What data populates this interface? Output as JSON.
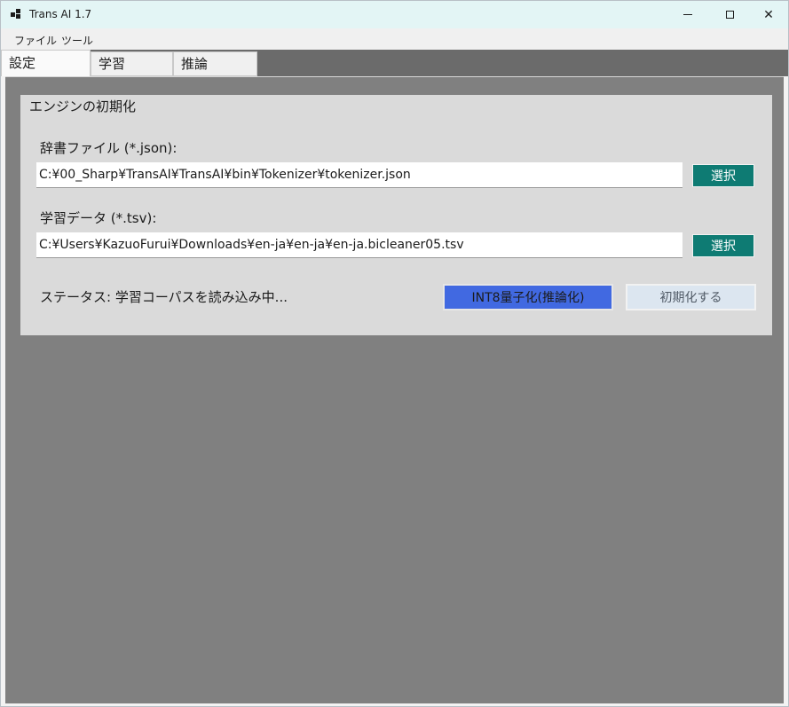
{
  "window": {
    "title": "Trans AI 1.7",
    "controls": {
      "minimize": "—",
      "maximize": "□",
      "close": "✕"
    }
  },
  "menu": {
    "items": [
      "ファイル",
      "ツール"
    ]
  },
  "tabs": [
    "設定",
    "学習",
    "推論"
  ],
  "active_tab": "設定",
  "engine": {
    "group_title": "エンジンの初期化",
    "dict_label": "辞書ファイル (*.json):",
    "dict_path": "C:¥00_Sharp¥TransAI¥TransAI¥bin¥Tokenizer¥tokenizer.json",
    "data_label": "学習データ (*.tsv):",
    "data_path": "C:¥Users¥KazuoFurui¥Downloads¥en-ja¥en-ja¥en-ja.bicleaner05.tsv",
    "select_label": "選択",
    "status": "ステータス: 学習コーパスを読み込み中...",
    "int8_label": "INT8量子化(推論化)",
    "init_label": "初期化する"
  },
  "colors": {
    "select_button": "#0e7b73",
    "int8_button": "#4169e1",
    "init_button": "#dce6f0",
    "titlebar": "#e3f5f5",
    "content_bg": "#808080"
  }
}
